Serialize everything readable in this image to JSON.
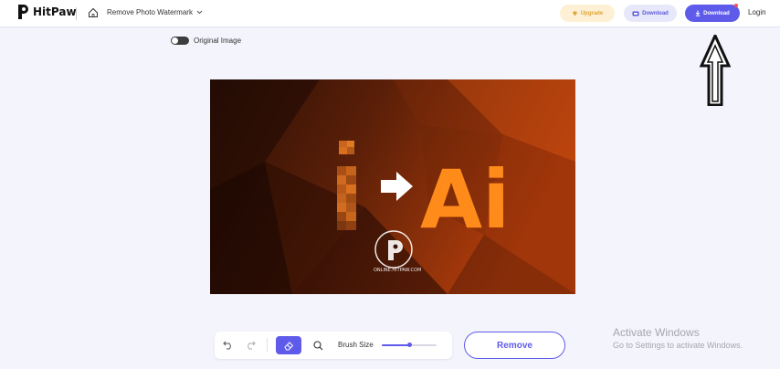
{
  "header": {
    "logo_text": "HitPaw",
    "tool_name": "Remove Photo Watermark",
    "upgrade_label": "Upgrade",
    "download_app_label": "Download",
    "download_label": "Download",
    "login_label": "Login"
  },
  "toggle": {
    "label": "Original Image",
    "on": false
  },
  "image": {
    "left_glyph": "i",
    "right_glyph": "Ai",
    "watermark_text": "ONLINE.HITPAW.COM"
  },
  "toolbar": {
    "brush_label": "Brush Size",
    "brush_size_fraction": 0.5
  },
  "remove_label": "Remove",
  "os_notice": {
    "title": "Activate Windows",
    "subtitle": "Go to Settings to activate Windows."
  },
  "colors": {
    "accent": "#5f5bea",
    "upgrade_text": "#e0a43a",
    "image_orange": "#ff8c1a"
  }
}
